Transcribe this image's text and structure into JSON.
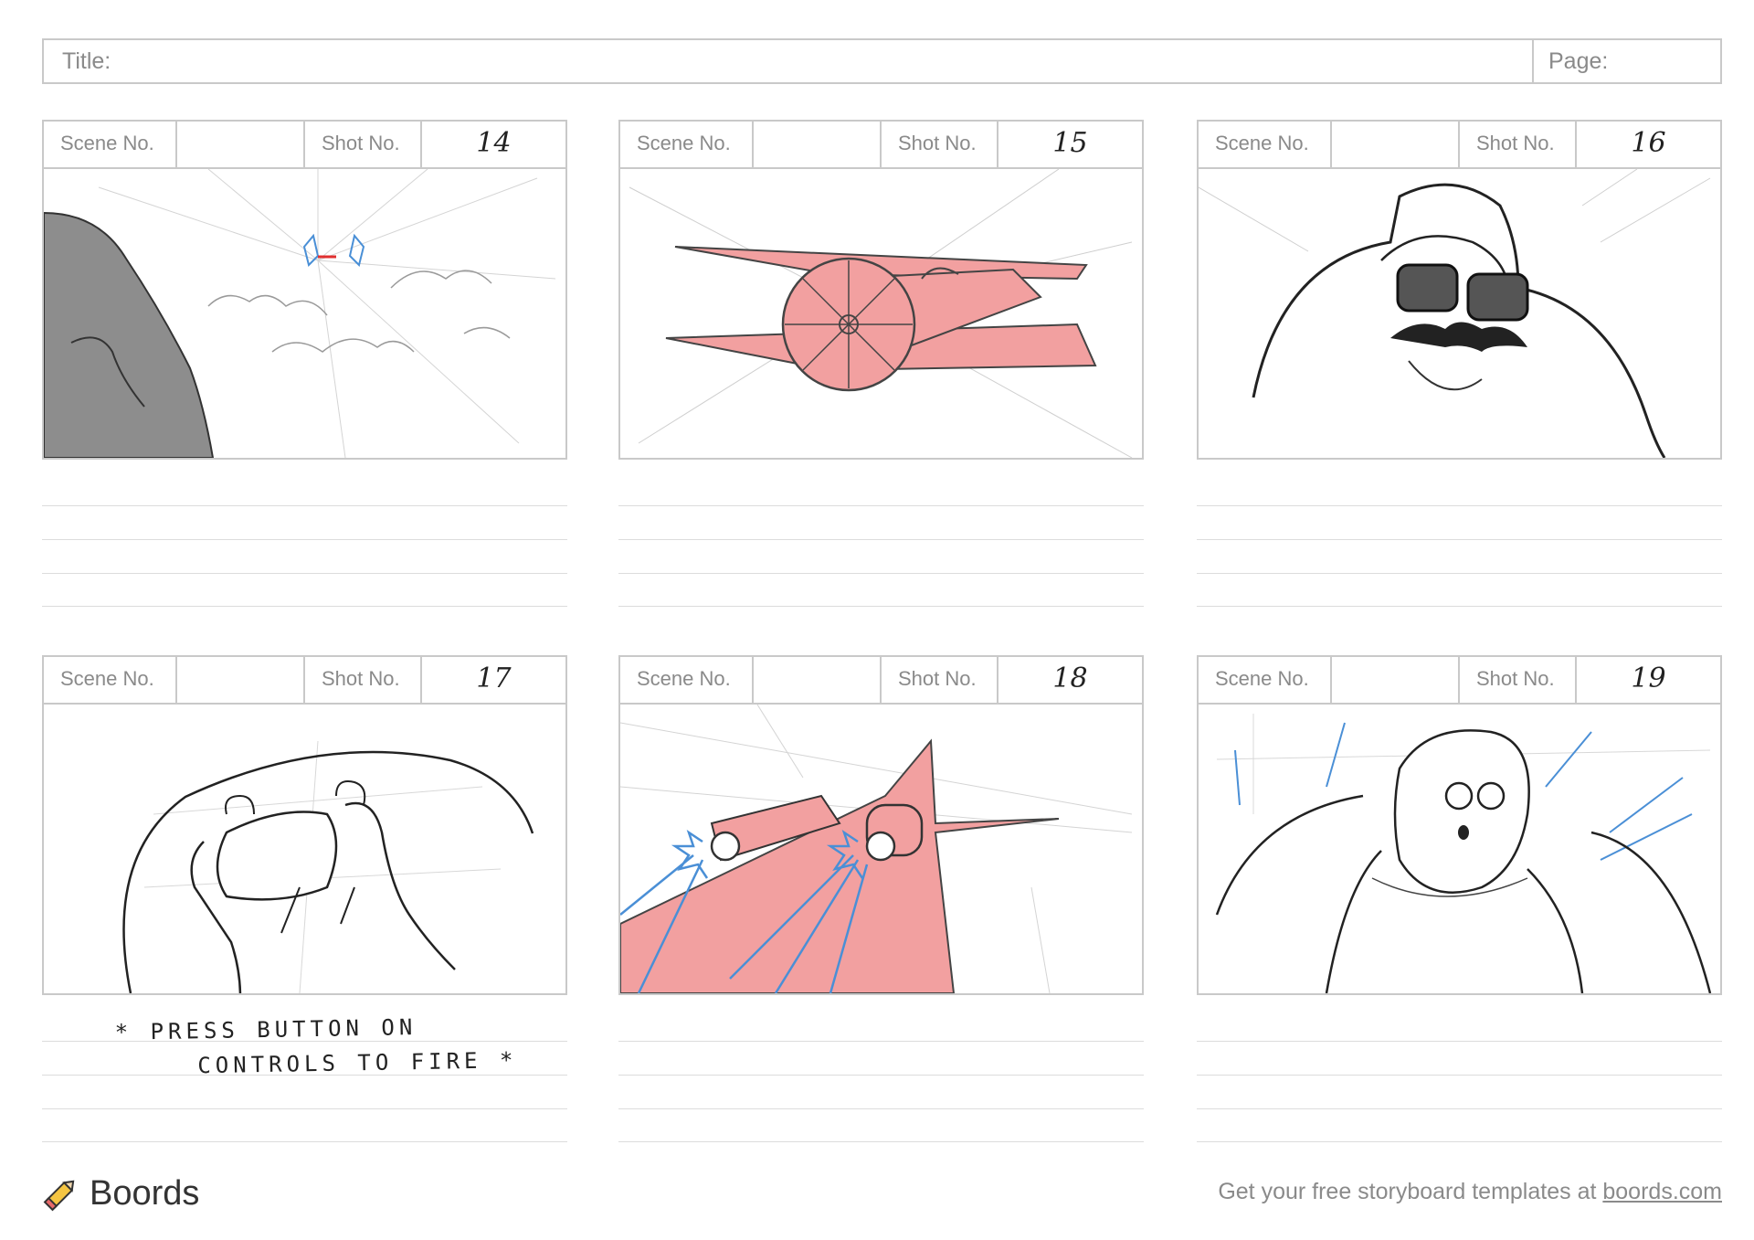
{
  "header": {
    "title_label": "Title:",
    "page_label": "Page:"
  },
  "panels": [
    {
      "scene_label": "Scene No.",
      "shot_label": "Shot No.",
      "scene_number": "",
      "shot_number": "14",
      "note": ""
    },
    {
      "scene_label": "Scene No.",
      "shot_label": "Shot No.",
      "scene_number": "",
      "shot_number": "15",
      "note": ""
    },
    {
      "scene_label": "Scene No.",
      "shot_label": "Shot No.",
      "scene_number": "",
      "shot_number": "16",
      "note": ""
    },
    {
      "scene_label": "Scene No.",
      "shot_label": "Shot No.",
      "scene_number": "",
      "shot_number": "17",
      "note_line1": "* PRESS BUTTON ON",
      "note_line2": "CONTROLS TO FIRE *"
    },
    {
      "scene_label": "Scene No.",
      "shot_label": "Shot No.",
      "scene_number": "",
      "shot_number": "18",
      "note": ""
    },
    {
      "scene_label": "Scene No.",
      "shot_label": "Shot No.",
      "scene_number": "",
      "shot_number": "19",
      "note": ""
    }
  ],
  "footer": {
    "brand": "Boords",
    "cta_text": "Get your free storyboard templates at ",
    "cta_link": "boords.com"
  },
  "colors": {
    "border": "#c9c9c9",
    "sketch_red": "#f2a0a0",
    "sketch_blue": "#4a8fd6"
  }
}
